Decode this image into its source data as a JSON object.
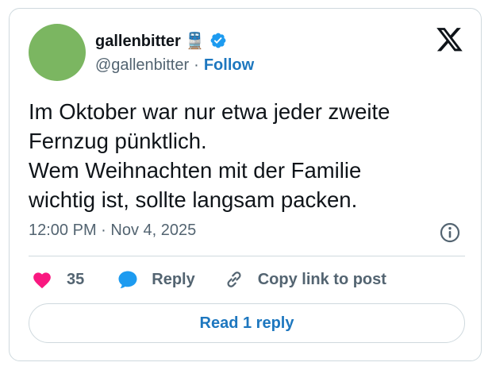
{
  "author": {
    "display_name": "gallenbitter 🚆",
    "handle": "@gallenbitter",
    "separator": "·",
    "follow_label": "Follow",
    "avatar_color": "#7bb661",
    "verified_color": "#1d9bf0"
  },
  "tweet": {
    "lines": [
      "Im Oktober war nur etwa jeder zweite",
      "Fernzug pünktlich.",
      "Wem Weihnachten mit der Familie",
      "wichtig ist, sollte langsam packen."
    ],
    "timestamp": "12:00 PM · Nov 4, 2025"
  },
  "actions": {
    "like_count": "35",
    "like_color": "#f91880",
    "reply_label": "Reply",
    "reply_color": "#1d9bf0",
    "copy_label": "Copy link to post"
  },
  "read_replies_label": "Read 1 reply",
  "icons": {
    "brand": "x-logo-icon",
    "info": "info-icon",
    "like": "heart-icon",
    "reply": "speech-bubble-icon",
    "copy": "link-icon",
    "verified": "verified-badge-icon"
  }
}
